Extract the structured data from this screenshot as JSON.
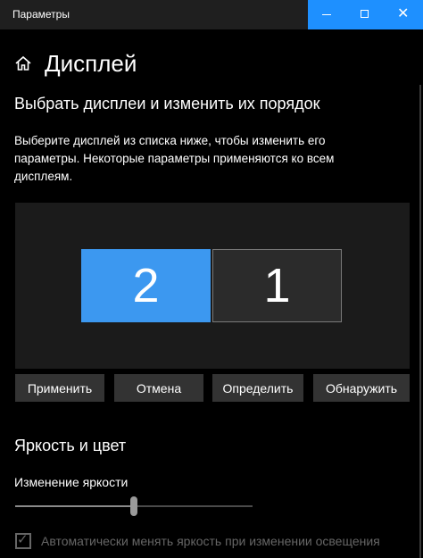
{
  "window": {
    "title": "Параметры",
    "caption_buttons": {
      "minimize": "minimize-icon",
      "maximize": "maximize-icon",
      "close": "close-icon"
    },
    "accent_color": "#1e90ff"
  },
  "header": {
    "icon": "home-icon",
    "title": "Дисплей"
  },
  "arrange_section": {
    "title": "Выбрать дисплеи и изменить их порядок",
    "description": "Выберите дисплей из списка ниже, чтобы изменить его параметры. Некоторые параметры применяются ко всем дисплеям.",
    "displays": [
      {
        "label": "2",
        "selected": true
      },
      {
        "label": "1",
        "selected": false
      }
    ],
    "selected_color": "#3c98f0",
    "buttons": {
      "apply": "Применить",
      "cancel": "Отмена",
      "identify": "Определить",
      "detect": "Обнаружить"
    }
  },
  "brightness_section": {
    "title": "Яркость и цвет",
    "slider_label": "Изменение яркости",
    "brightness_level": 0.5,
    "auto_brightness": {
      "label": "Автоматически менять яркость при изменении освещения",
      "checked": true,
      "enabled": false
    }
  }
}
